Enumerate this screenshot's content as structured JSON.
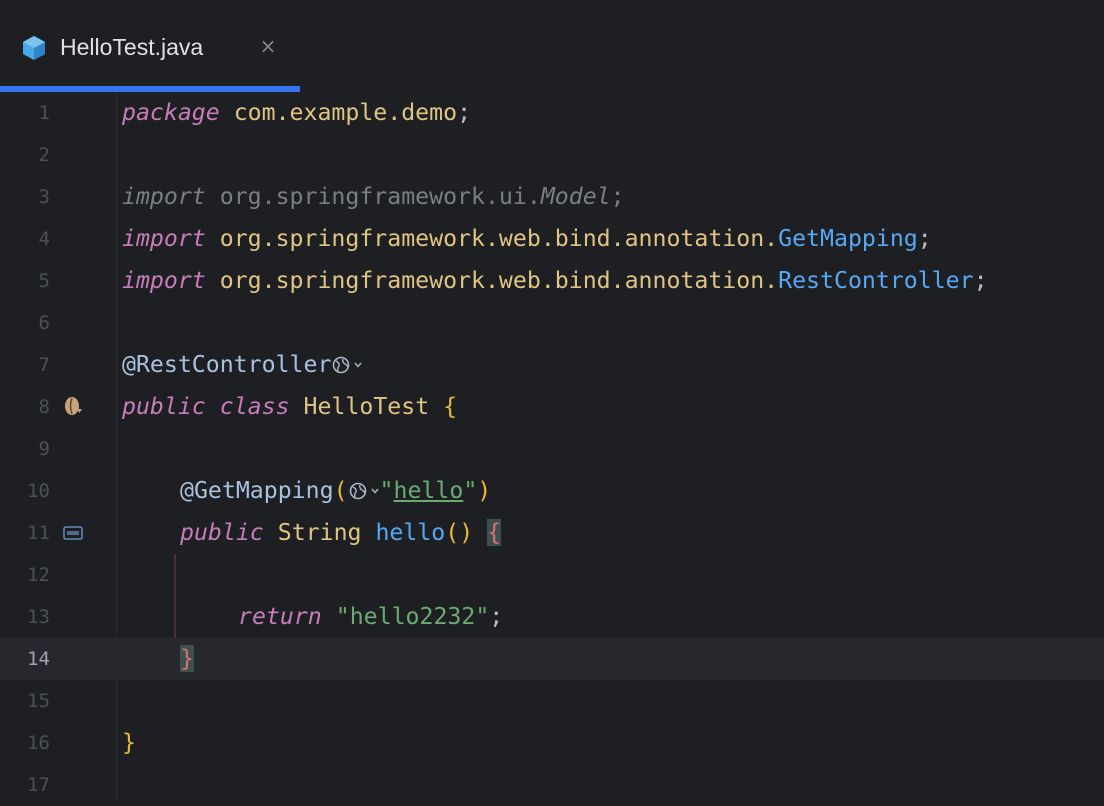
{
  "tab": {
    "title": "HelloTest.java",
    "close_glyph": "×",
    "file_icon": "java-class-icon",
    "accent": "#3574f0"
  },
  "editor": {
    "current_line": 14,
    "line_numbers": [
      "1",
      "2",
      "3",
      "4",
      "5",
      "6",
      "7",
      "8",
      "9",
      "10",
      "11",
      "12",
      "13",
      "14",
      "15",
      "16",
      "17"
    ],
    "tokens": {
      "l1_kw": "package",
      "l1_pkg": "com.example.demo",
      "l1_end": ";",
      "l3_kw": "import",
      "l3_pkg": "org.springframework.ui.",
      "l3_cls": "Model",
      "l3_end": ";",
      "l4_kw": "import",
      "l4_pkg": "org.springframework.web.bind.annotation.",
      "l4_cls": "GetMapping",
      "l4_end": ";",
      "l5_kw": "import",
      "l5_pkg": "org.springframework.web.bind.annotation.",
      "l5_cls": "RestController",
      "l5_end": ";",
      "l7_ann": "@RestController",
      "l8_kw1": "public",
      "l8_kw2": "class",
      "l8_name": "HelloTest",
      "l8_brace": "{",
      "l10_ann": "@GetMapping",
      "l10_paren_open": "(",
      "l10_quote_open": "\"",
      "l10_path": "hello",
      "l10_quote_close": "\"",
      "l10_paren_close": ")",
      "l11_kw": "public",
      "l11_type": "String",
      "l11_fn": "hello",
      "l11_parens": "()",
      "l11_brace": "{",
      "l13_kw": "return",
      "l13_str": "\"hello2232\"",
      "l13_end": ";",
      "l14_brace": "}",
      "l16_brace": "}"
    },
    "gutter_icons": [
      "bean-icon",
      "api-icon"
    ],
    "inline_icons": [
      "web-globe-icon",
      "chevron-down-icon"
    ]
  }
}
